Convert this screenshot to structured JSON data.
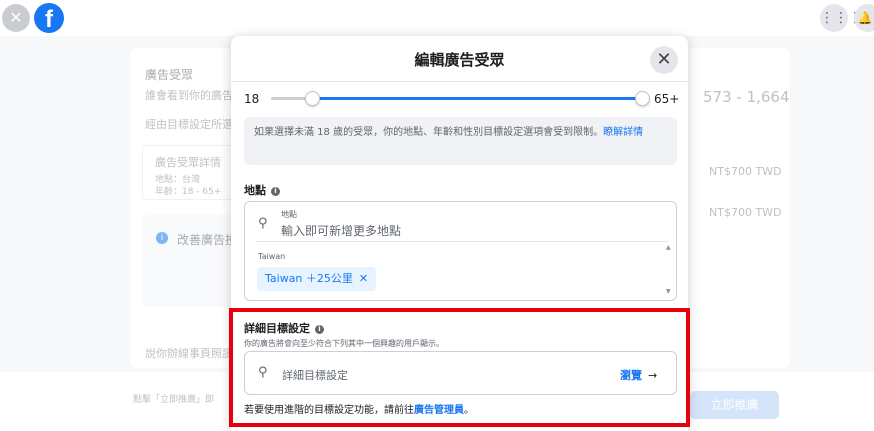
{
  "topbar": {
    "close_icon": "✕",
    "logo_letter": "f",
    "grid_icon": "⋮⋮⋮",
    "bell_icon": "🔔"
  },
  "background": {
    "audience_title": "廣告受眾",
    "audience_desc": "誰會看到你的廣告",
    "source_text": "經由目標設定所選",
    "detail_title": "廣告受眾詳情",
    "detail_line1": "地點：台灣",
    "detail_line2": "年齡：18 - 65+",
    "improve_title": "改善廣告投",
    "reach_range": "573 - 1,664",
    "price1": "NT$700 TWD",
    "price2": "NT$700 TWD",
    "more_link": "說你辦線事頁照讀",
    "footer_text": "點擊「立即推廣」即",
    "push_button": "立即推廣"
  },
  "modal": {
    "title": "編輯廣告受眾",
    "close_icon": "✕",
    "age": {
      "min_label": "18",
      "max_label": "65+",
      "min_value": 18,
      "max_value": 65
    },
    "notice": {
      "text": "如果選擇未滿 18 歲的受眾，你的地點、年齡和性別目標設定選項會受到限制。",
      "link": "瞭解詳情"
    },
    "location": {
      "label": "地點",
      "info_icon": "i",
      "search_icon": "⚲",
      "field_label": "地點",
      "placeholder": "輸入即可新增更多地點",
      "country": "Taiwan",
      "tag": "Taiwan ＋25公里",
      "tag_remove": "✕"
    },
    "detailed": {
      "label": "詳細目標設定",
      "info_icon": "i",
      "sub": "你的廣告將會向至少符合下列其中一個興趣的用戶顯示。",
      "search_icon": "⚲",
      "placeholder": "詳細目標設定",
      "browse": "瀏覽",
      "browse_arrow": "→",
      "note_prefix": "若要使用進階的目標設定功能，請前往",
      "note_link": "廣告管理員",
      "note_suffix": "。"
    }
  }
}
